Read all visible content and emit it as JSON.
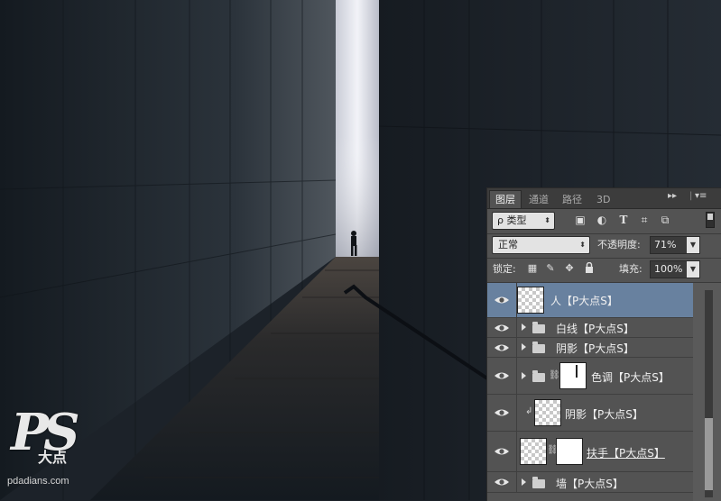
{
  "watermark": {
    "ps": "PS",
    "cn": "大点",
    "site": "pdadians.com"
  },
  "panel": {
    "tabs": [
      {
        "label": "图层",
        "active": true
      },
      {
        "label": "通道",
        "active": false
      },
      {
        "label": "路径",
        "active": false
      },
      {
        "label": "3D",
        "active": false
      }
    ],
    "collapse_icon": "double-arrow-right-icon",
    "menu_icon": "panel-menu-icon",
    "filter": {
      "kind_label": "ρ 类型",
      "icons": [
        "image-filter-icon",
        "adjustment-filter-icon",
        "type-filter-icon",
        "shape-filter-icon",
        "smart-object-filter-icon"
      ],
      "icon_glyphs": [
        "▣",
        "◐",
        "T",
        "⌗",
        "⧉"
      ]
    },
    "blend_mode": "正常",
    "opacity_label": "不透明度:",
    "opacity_value": "71%",
    "lock_label": "锁定:",
    "lock_icons": [
      "lock-transparent-icon",
      "lock-image-icon",
      "lock-position-icon",
      "lock-all-icon"
    ],
    "lock_glyphs": [
      "▦",
      "✎",
      "✥",
      "🔒"
    ],
    "fill_label": "填充:",
    "fill_value": "100%",
    "layers": [
      {
        "name": "人【P大点S】",
        "type": "layer",
        "selected": true
      },
      {
        "name": "白线【P大点S】",
        "type": "group",
        "selected": false
      },
      {
        "name": "阴影【P大点S】",
        "type": "group",
        "selected": false
      },
      {
        "name": "色调【P大点S】",
        "type": "group-mask",
        "selected": false
      },
      {
        "name": "阴影【P大点S】",
        "type": "clipped",
        "selected": false
      },
      {
        "name": "扶手【P大点S】",
        "type": "layer-mask",
        "selected": false
      },
      {
        "name": "墙【P大点S】",
        "type": "group",
        "selected": false
      }
    ]
  },
  "colors": {
    "panel_bg": "#535353",
    "selected_row": "#68819f",
    "wall_dark": "#1b2128"
  }
}
